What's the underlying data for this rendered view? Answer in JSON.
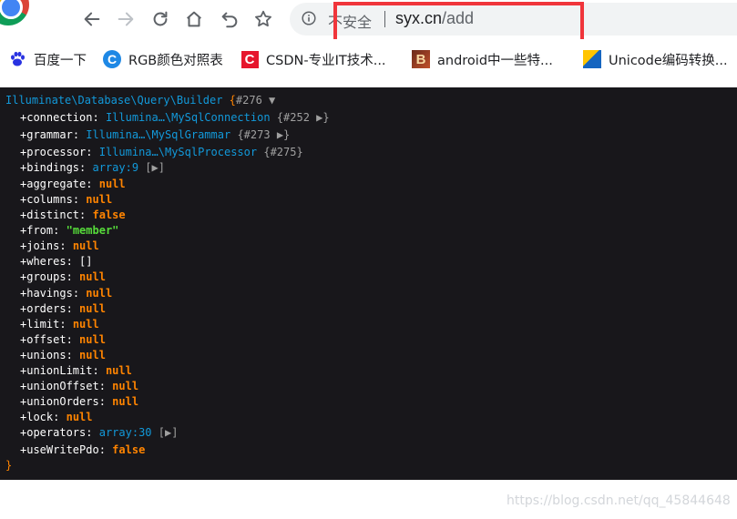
{
  "browser": {
    "security_label": "不安全",
    "url_host": "syx.cn",
    "url_path": "/add"
  },
  "bookmarks": [
    {
      "label": "百度一下",
      "icon": "baidu-paw-icon"
    },
    {
      "label": "RGB颜色对照表",
      "icon": "rgb-c-icon"
    },
    {
      "label": "CSDN-专业IT技术...",
      "icon": "csdn-icon"
    },
    {
      "label": "android中一些特...",
      "icon": "android-b-icon"
    },
    {
      "label": "Unicode编码转换...",
      "icon": "unicode-flag-icon"
    }
  ],
  "dump": {
    "class_name": "Illuminate\\Database\\Query\\Builder",
    "brace_open": "{",
    "object_ref": "#276",
    "toggle": "▼",
    "brace_close": "}",
    "props": [
      {
        "key": "connection",
        "value": "Illumina…\\MySqlConnection",
        "type": "class",
        "ref": "{#252",
        "suffix": "▶}"
      },
      {
        "key": "grammar",
        "value": "Illumina…\\MySqlGrammar",
        "type": "class",
        "ref": "{#273",
        "suffix": "▶}"
      },
      {
        "key": "processor",
        "value": "Illumina…\\MySqlProcessor",
        "type": "class",
        "ref": "{#275}",
        "suffix": ""
      },
      {
        "key": "bindings",
        "value": "array:9",
        "type": "note",
        "ref": "",
        "suffix": "[▶]"
      },
      {
        "key": "aggregate",
        "value": "null",
        "type": "null",
        "ref": "",
        "suffix": ""
      },
      {
        "key": "columns",
        "value": "null",
        "type": "null",
        "ref": "",
        "suffix": ""
      },
      {
        "key": "distinct",
        "value": "false",
        "type": "null",
        "ref": "",
        "suffix": ""
      },
      {
        "key": "from",
        "value": "\"member\"",
        "type": "str",
        "ref": "",
        "suffix": ""
      },
      {
        "key": "joins",
        "value": "null",
        "type": "null",
        "ref": "",
        "suffix": ""
      },
      {
        "key": "wheres",
        "value": "[]",
        "type": "plain",
        "ref": "",
        "suffix": ""
      },
      {
        "key": "groups",
        "value": "null",
        "type": "null",
        "ref": "",
        "suffix": ""
      },
      {
        "key": "havings",
        "value": "null",
        "type": "null",
        "ref": "",
        "suffix": ""
      },
      {
        "key": "orders",
        "value": "null",
        "type": "null",
        "ref": "",
        "suffix": ""
      },
      {
        "key": "limit",
        "value": "null",
        "type": "null",
        "ref": "",
        "suffix": ""
      },
      {
        "key": "offset",
        "value": "null",
        "type": "null",
        "ref": "",
        "suffix": ""
      },
      {
        "key": "unions",
        "value": "null",
        "type": "null",
        "ref": "",
        "suffix": ""
      },
      {
        "key": "unionLimit",
        "value": "null",
        "type": "null",
        "ref": "",
        "suffix": ""
      },
      {
        "key": "unionOffset",
        "value": "null",
        "type": "null",
        "ref": "",
        "suffix": ""
      },
      {
        "key": "unionOrders",
        "value": "null",
        "type": "null",
        "ref": "",
        "suffix": ""
      },
      {
        "key": "lock",
        "value": "null",
        "type": "null",
        "ref": "",
        "suffix": ""
      },
      {
        "key": "operators",
        "value": "array:30",
        "type": "note",
        "ref": "",
        "suffix": "[▶]"
      },
      {
        "key": "useWritePdo",
        "value": "false",
        "type": "null",
        "ref": "",
        "suffix": ""
      }
    ]
  },
  "watermark": "https://blog.csdn.net/qq_45844648",
  "colors": {
    "dump_bg": "#18171b",
    "class": "#1299da",
    "keyword": "#ff8400",
    "string": "#56db3a",
    "highlight": "#f0353b"
  }
}
